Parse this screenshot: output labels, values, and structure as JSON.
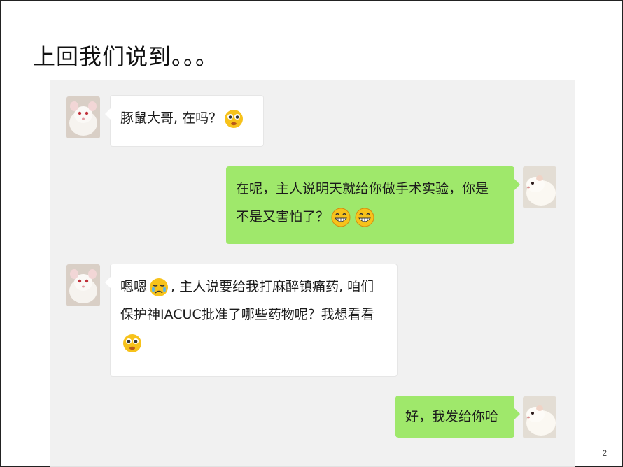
{
  "slide": {
    "title": "上回我们说到。。。",
    "page_number": "2"
  },
  "chat": {
    "messages": [
      {
        "side": "left",
        "avatar": "white-rat-avatar",
        "text_before": "豚鼠大哥, 在吗？",
        "emoji_after": "pleading-face-emoji"
      },
      {
        "side": "right",
        "avatar": "guinea-pig-avatar",
        "line1": "在呢，主人说明天就给你做手术实验，你是",
        "line2": "不是又害怕了？",
        "emoji_after": [
          "grinning-face-emoji",
          "grinning-face-emoji"
        ]
      },
      {
        "side": "left",
        "avatar": "white-rat-avatar",
        "prefix": "嗯嗯",
        "emoji_mid": "crying-face-emoji",
        "line1_rest": ", 主人说要给我打麻醉镇痛药, 咱们",
        "line2": "保护神IACUC批准了哪些药物呢？我想看看",
        "emoji_after": "pleading-face-emoji"
      },
      {
        "side": "right",
        "avatar": "guinea-pig-avatar",
        "text": "好，我发给你哈"
      }
    ]
  },
  "colors": {
    "chat_background": "#f1f1f1",
    "incoming_bubble": "#ffffff",
    "outgoing_bubble": "#9fe86b",
    "emoji_yellow": "#f7c21b"
  }
}
